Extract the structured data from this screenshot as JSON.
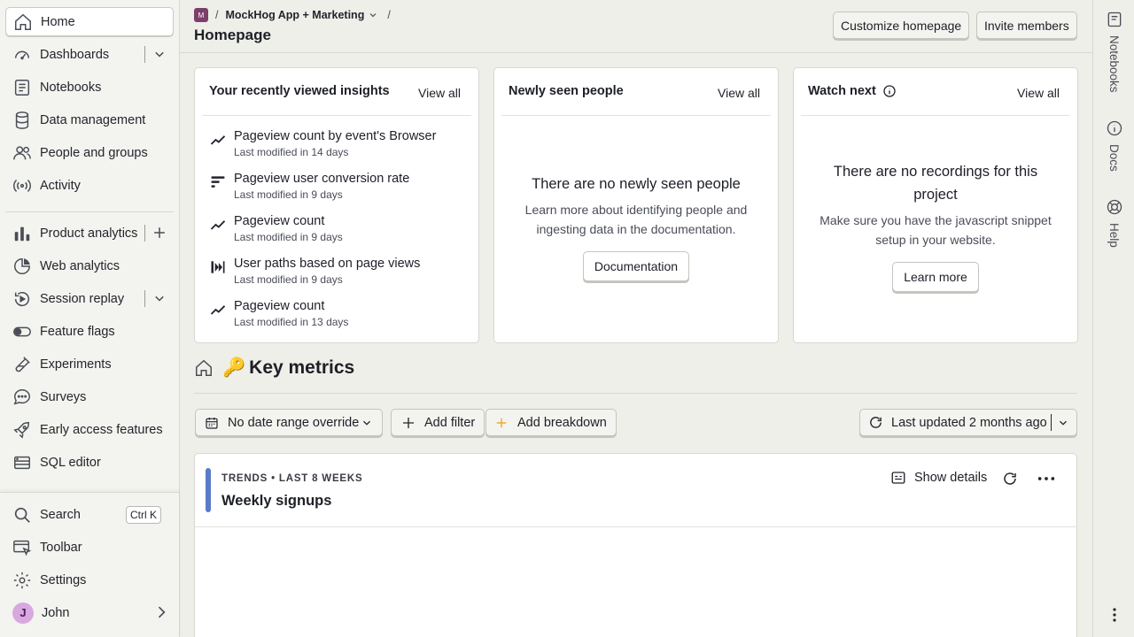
{
  "sidebar": {
    "items": [
      {
        "label": "Home",
        "icon": "home-icon"
      },
      {
        "label": "Dashboards",
        "icon": "dashboard-gauge-icon"
      },
      {
        "label": "Notebooks",
        "icon": "notebook-icon"
      },
      {
        "label": "Data management",
        "icon": "database-icon"
      },
      {
        "label": "People and groups",
        "icon": "people-icon"
      },
      {
        "label": "Activity",
        "icon": "activity-broadcast-icon"
      },
      {
        "label": "Product analytics",
        "icon": "bar-chart-icon"
      },
      {
        "label": "Web analytics",
        "icon": "pie-chart-icon"
      },
      {
        "label": "Session replay",
        "icon": "replay-icon"
      },
      {
        "label": "Feature flags",
        "icon": "toggle-icon"
      },
      {
        "label": "Experiments",
        "icon": "flask-icon"
      },
      {
        "label": "Surveys",
        "icon": "chat-bubble-icon"
      },
      {
        "label": "Early access features",
        "icon": "rocket-icon"
      },
      {
        "label": "SQL editor",
        "icon": "server-icon"
      }
    ],
    "bottom": {
      "search": "Search",
      "search_kbd": "Ctrl K",
      "toolbar": "Toolbar",
      "settings": "Settings",
      "user_initial": "J",
      "user_name": "John"
    }
  },
  "header": {
    "project_badge": "M",
    "project_name": "MockHog App + Marketing",
    "breadcrumb_sep": "/",
    "title": "Homepage",
    "customize_label": "Customize homepage",
    "invite_label": "Invite members"
  },
  "cards": {
    "insights": {
      "title": "Your recently viewed insights",
      "view_all": "View all",
      "items": [
        {
          "name": "Pageview count by event's Browser",
          "sub": "Last modified in 14 days",
          "icon": "trend-line-icon"
        },
        {
          "name": "Pageview user conversion rate",
          "sub": "Last modified in 9 days",
          "icon": "funnel-bars-icon"
        },
        {
          "name": "Pageview count",
          "sub": "Last modified in 9 days",
          "icon": "trend-line-icon"
        },
        {
          "name": "User paths based on page views",
          "sub": "Last modified in 9 days",
          "icon": "paths-icon"
        },
        {
          "name": "Pageview count",
          "sub": "Last modified in 13 days",
          "icon": "trend-line-icon"
        }
      ]
    },
    "people": {
      "title": "Newly seen people",
      "view_all": "View all",
      "empty_title": "There are no newly seen people",
      "empty_desc": "Learn more about identifying people and ingesting data in the documentation.",
      "button": "Documentation"
    },
    "watch": {
      "title": "Watch next",
      "view_all": "View all",
      "empty_title": "There are no recordings for this project",
      "empty_desc": "Make sure you have the javascript snippet setup in your website.",
      "button": "Learn more"
    }
  },
  "key_metrics": {
    "emoji": "🔑",
    "title": "Key metrics",
    "date_filter": "No date range override",
    "add_filter": "Add filter",
    "add_breakdown": "Add breakdown",
    "last_updated": "Last updated 2 months ago"
  },
  "tile": {
    "kicker": "TRENDS • LAST 8 WEEKS",
    "title": "Weekly signups",
    "show_details": "Show details",
    "accent_color": "#5b7ac9"
  },
  "right_rail": {
    "notebooks": "Notebooks",
    "docs": "Docs",
    "help": "Help"
  },
  "colors": {
    "background": "#eeefe9",
    "card": "#ffffff",
    "border": "#d7d8d0",
    "project_badge": "#7c3f6b",
    "add_breakdown_plus": "#f1a82c"
  }
}
